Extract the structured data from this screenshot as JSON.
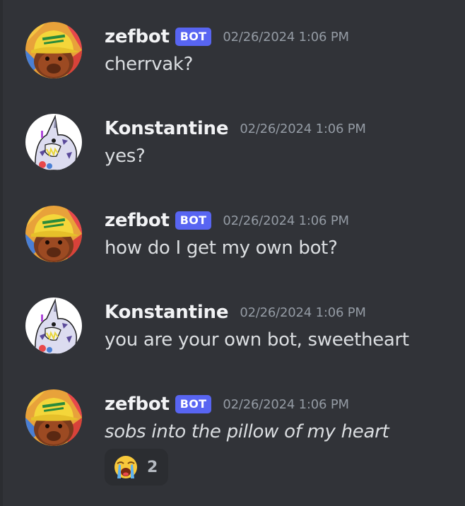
{
  "messages": [
    {
      "author": "zefbot",
      "bot_tag": "BOT",
      "timestamp": "02/26/2024 1:06 PM",
      "text": "cherrvak?",
      "avatar": "capybara-hat-avatar"
    },
    {
      "author": "Konstantine",
      "timestamp": "02/26/2024 1:06 PM",
      "text": "yes?",
      "avatar": "wolf-monster-avatar"
    },
    {
      "author": "zefbot",
      "bot_tag": "BOT",
      "timestamp": "02/26/2024 1:06 PM",
      "text": "how do I get my own bot?",
      "avatar": "capybara-hat-avatar"
    },
    {
      "author": "Konstantine",
      "timestamp": "02/26/2024 1:06 PM",
      "text": "you are your own bot, sweetheart",
      "avatar": "wolf-monster-avatar"
    },
    {
      "author": "zefbot",
      "bot_tag": "BOT",
      "timestamp": "02/26/2024 1:06 PM",
      "text": "sobs into the pillow of my heart",
      "text_style": "italic",
      "avatar": "capybara-hat-avatar",
      "reactions": [
        {
          "emoji": "loudly-crying-face-icon",
          "count": "2"
        }
      ]
    }
  ],
  "colors": {
    "background": "#313338",
    "bot_tag": "#5865f2",
    "timestamp": "#949ba4",
    "text": "#dbdee1",
    "reaction_bg": "#2b2d31"
  }
}
